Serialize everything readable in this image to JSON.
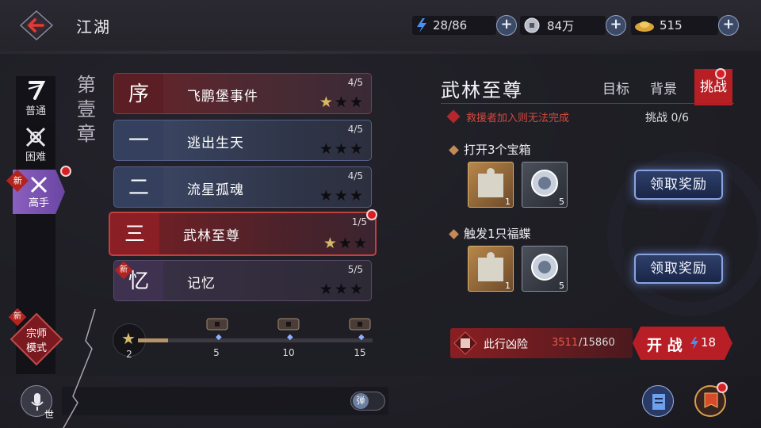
{
  "header": {
    "title": "江湖",
    "energy": "28/86",
    "silver": "84万",
    "gold": "515"
  },
  "difficulty": [
    {
      "label": "普通",
      "icon": "brush-icon"
    },
    {
      "label": "困难",
      "icon": "crossed-swords-icon"
    },
    {
      "label": "高手",
      "icon": "swords-icon",
      "new": "新"
    }
  ],
  "chapter_label": [
    "第",
    "壹",
    "章"
  ],
  "stages": [
    {
      "num": "序",
      "name": "飞鹏堡事件",
      "progress": "4/5",
      "stars": 1
    },
    {
      "num": "一",
      "name": "逃出生天",
      "progress": "4/5",
      "stars": 0
    },
    {
      "num": "二",
      "name": "流星孤魂",
      "progress": "4/5",
      "stars": 0
    },
    {
      "num": "三",
      "name": "武林至尊",
      "progress": "1/5",
      "stars": 1
    },
    {
      "num": "忆",
      "name": "记忆",
      "progress": "5/5",
      "stars": 0,
      "new": "新"
    }
  ],
  "star_progress": {
    "current": "2",
    "milestones": [
      "5",
      "10",
      "15"
    ],
    "fill_fraction": 0.13
  },
  "master_mode": {
    "new": "新",
    "line1": "宗师",
    "line2": "模式"
  },
  "detail": {
    "title": "武林至尊",
    "tabs": [
      "目标",
      "背景",
      "挑战"
    ],
    "warning": "救援者加入则无法完成",
    "challenge_label": "挑战",
    "challenge_count": "0/6",
    "quests": [
      {
        "text": "打开3个宝箱",
        "rewards": [
          {
            "qty": "1"
          },
          {
            "qty": "5"
          }
        ],
        "claim": "领取奖励"
      },
      {
        "text": "触发1只福蝶",
        "rewards": [
          {
            "qty": "1"
          },
          {
            "qty": "5"
          }
        ],
        "claim": "领取奖励"
      }
    ],
    "danger_label": "此行凶险",
    "danger_value": "3511",
    "danger_max": "/15860",
    "start_label": "开 战",
    "start_cost": "18"
  },
  "bottom": {
    "world": "世",
    "danmaku": "弹"
  }
}
